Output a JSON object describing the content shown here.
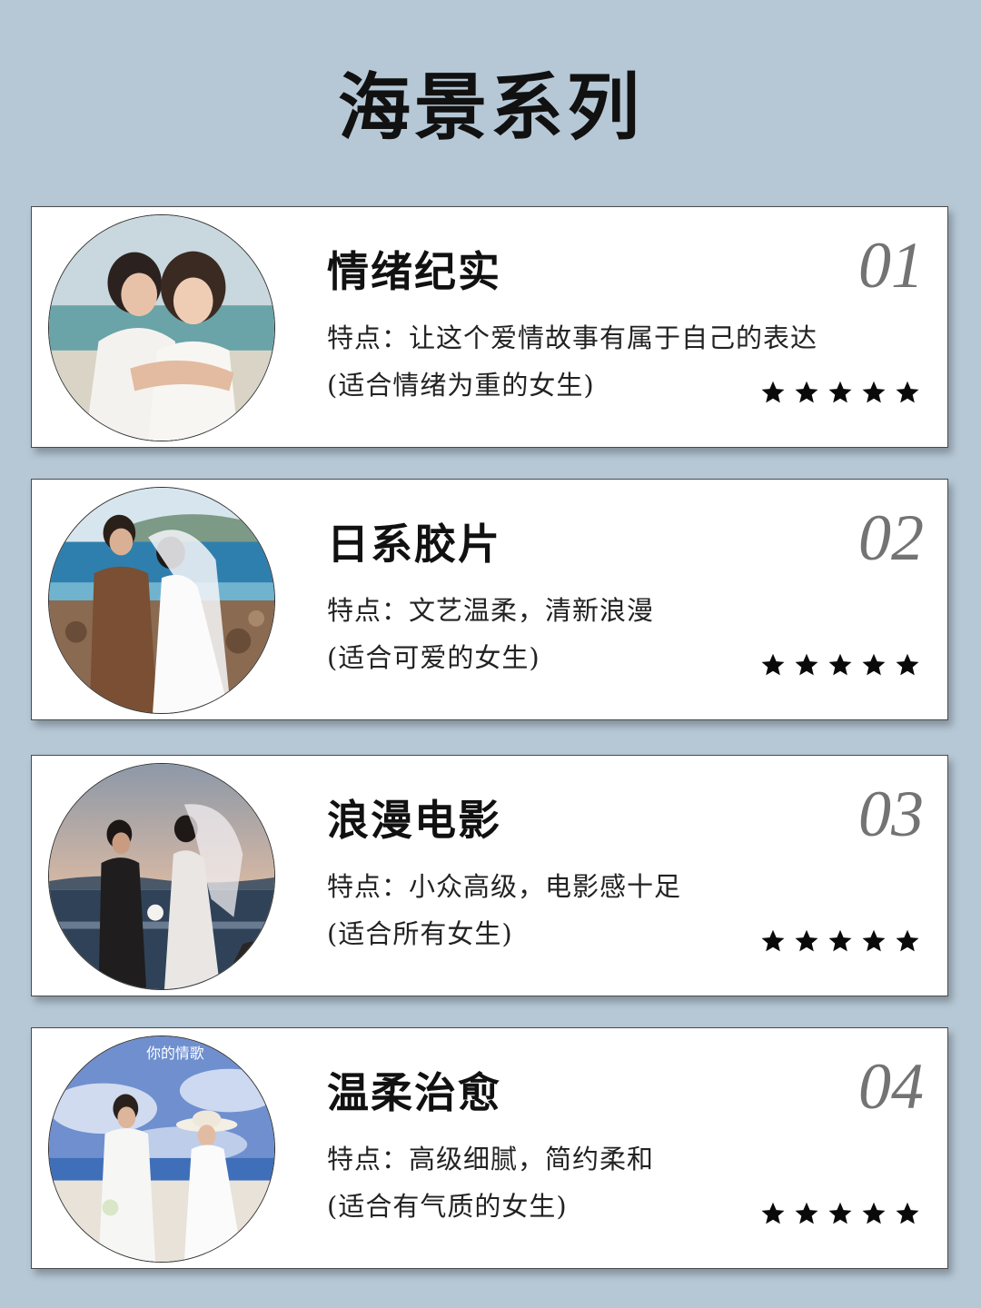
{
  "page": {
    "title": "海景系列"
  },
  "cards": [
    {
      "number": "01",
      "name": "情绪纪实",
      "feature": "特点：让这个爱情故事有属于自己的表达",
      "suitable": "(适合情绪为重的女生)",
      "rating": 5
    },
    {
      "number": "02",
      "name": "日系胶片",
      "feature": "特点：文艺温柔，清新浪漫",
      "suitable": "(适合可爱的女生)",
      "rating": 5
    },
    {
      "number": "03",
      "name": "浪漫电影",
      "feature": "特点：小众高级，电影感十足",
      "suitable": "(适合所有女生)",
      "rating": 5
    },
    {
      "number": "04",
      "name": "温柔治愈",
      "feature": "特点：高级细腻，简约柔和",
      "suitable": "(适合有气质的女生)",
      "rating": 5,
      "photo_overlay_text": "你的情歌"
    }
  ]
}
